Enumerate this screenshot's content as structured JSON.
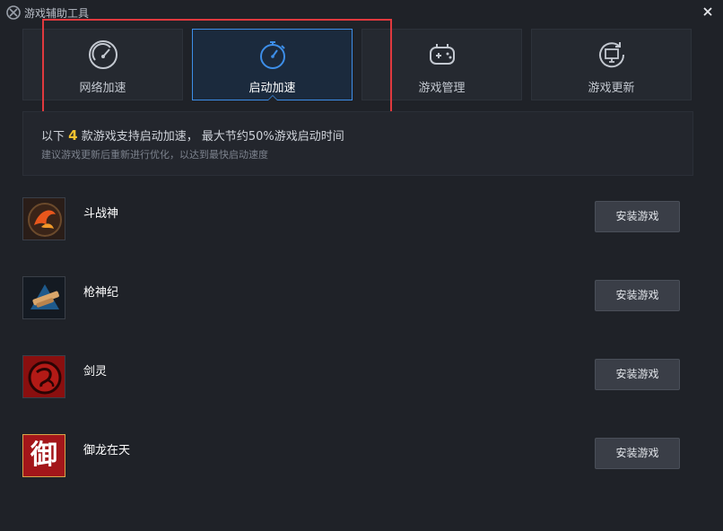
{
  "window": {
    "title": "游戏辅助工具"
  },
  "tabs": [
    {
      "label": "网络加速",
      "icon": "speedometer-icon",
      "active": false
    },
    {
      "label": "启动加速",
      "icon": "stopwatch-icon",
      "active": true
    },
    {
      "label": "游戏管理",
      "icon": "gamepad-icon",
      "active": false
    },
    {
      "label": "游戏更新",
      "icon": "update-monitor-icon",
      "active": false
    }
  ],
  "info": {
    "prefix": "以下",
    "count": "4",
    "suffix": "款游戏支持启动加速， 最大节约50%游戏启动时间",
    "hint": "建议游戏更新后重新进行优化，以达到最快启动速度"
  },
  "games": [
    {
      "name": "斗战神",
      "button": "安装游戏"
    },
    {
      "name": "枪神纪",
      "button": "安装游戏"
    },
    {
      "name": "剑灵",
      "button": "安装游戏"
    },
    {
      "name": "御龙在天",
      "button": "安装游戏",
      "icon_char": "御"
    }
  ],
  "colors": {
    "accent": "#3d8ee8",
    "highlight_border": "#e0393e",
    "count_yellow": "#f2c230",
    "background": "#1f2228"
  }
}
